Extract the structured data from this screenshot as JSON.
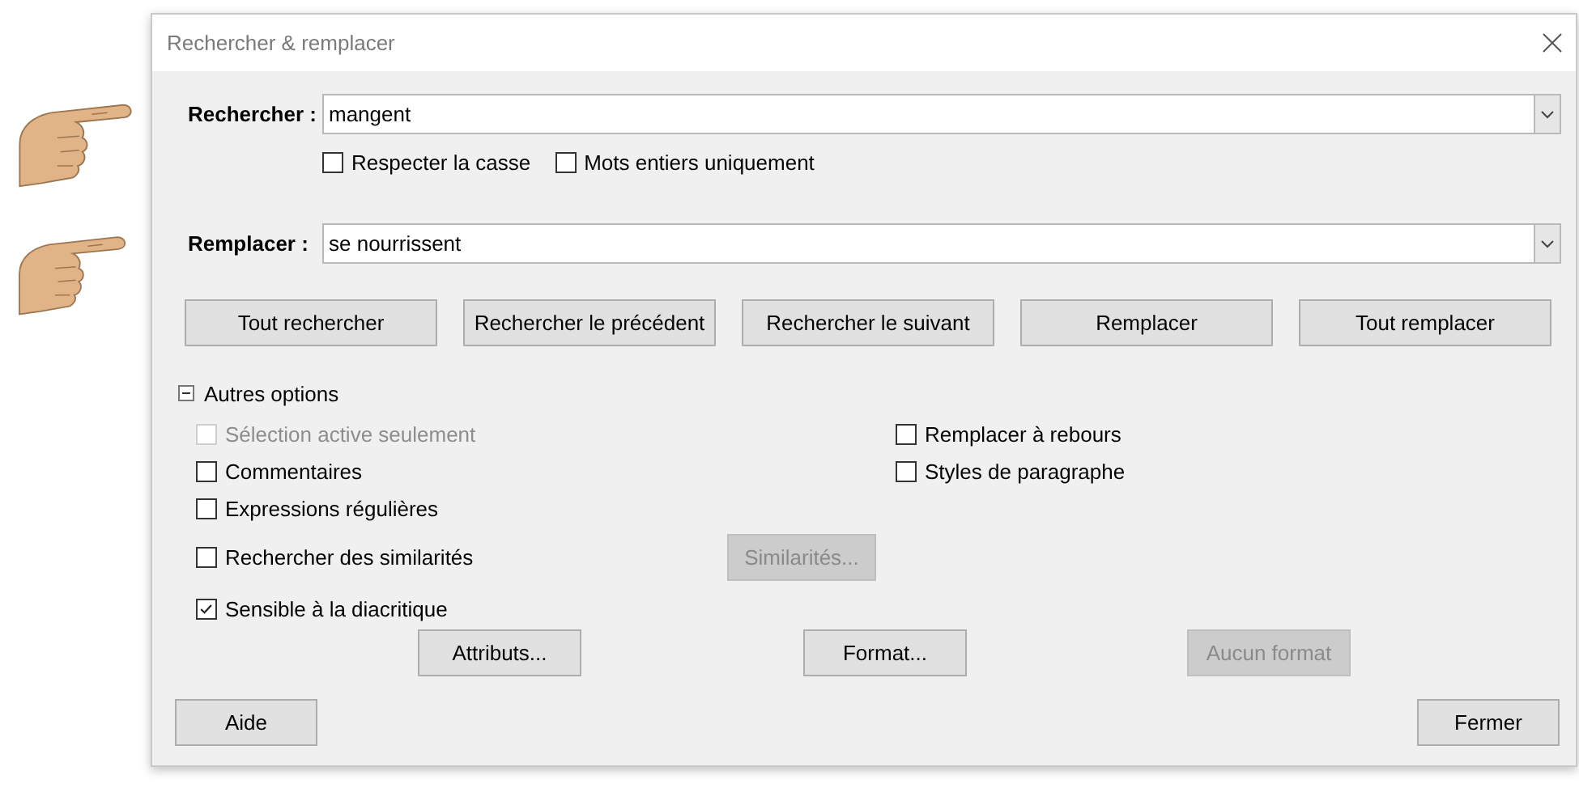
{
  "window": {
    "title": "Rechercher & remplacer"
  },
  "search": {
    "label": "Rechercher :",
    "value": "mangent"
  },
  "search_options": [
    {
      "label": "Respecter la casse",
      "checked": false
    },
    {
      "label": "Mots entiers uniquement",
      "checked": false
    }
  ],
  "replace": {
    "label": "Remplacer :",
    "value": "se nourrissent"
  },
  "action_buttons": [
    {
      "label": "Tout rechercher"
    },
    {
      "label": "Rechercher le précédent"
    },
    {
      "label": "Rechercher le suivant"
    },
    {
      "label": "Remplacer"
    },
    {
      "label": "Tout remplacer"
    }
  ],
  "other_options": {
    "label": "Autres options",
    "expanded": true,
    "left_options": [
      {
        "label": "Sélection active seulement",
        "checked": false,
        "disabled": true
      },
      {
        "label": "Commentaires",
        "checked": false,
        "disabled": false
      },
      {
        "label": "Expressions régulières",
        "checked": false,
        "disabled": false
      },
      {
        "label": "Rechercher des similarités",
        "checked": false,
        "disabled": false,
        "button": {
          "label": "Similarités...",
          "disabled": true
        }
      },
      {
        "label": "Sensible à la diacritique",
        "checked": true,
        "disabled": false
      }
    ],
    "right_options": [
      {
        "label": "Remplacer à rebours",
        "checked": false,
        "disabled": false
      },
      {
        "label": "Styles de paragraphe",
        "checked": false,
        "disabled": false
      }
    ],
    "format_buttons": [
      {
        "label": "Attributs...",
        "disabled": false
      },
      {
        "label": "Format...",
        "disabled": false
      },
      {
        "label": "Aucun format",
        "disabled": true
      }
    ]
  },
  "footer_buttons": [
    {
      "label": "Aide"
    },
    {
      "label": "Fermer"
    }
  ]
}
